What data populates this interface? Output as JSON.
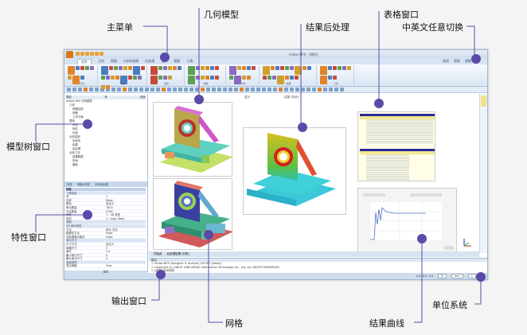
{
  "callouts": {
    "main_menu": "主菜单",
    "geometry_model": "几何模型",
    "post_processing": "结果后处理",
    "table_window": "表格窗口",
    "language_switch": "中英文任意切换",
    "model_tree_window": "模型树窗口",
    "property_window": "特性窗口",
    "output_window": "输出窗口",
    "mesh": "网格",
    "result_curve": "结果曲线",
    "unit_system": "单位系统"
  },
  "app": {
    "title": "midas NFX - [模型]",
    "tabs": [
      "文件",
      "几何",
      "网格",
      "分析&结果",
      "后处理",
      "工具",
      "视图",
      "工具"
    ],
    "right_menu": [
      "选项",
      "帮助",
      "视图"
    ],
    "ribbon_groups": [
      "几何",
      "特征",
      "变换",
      "网格",
      "分析",
      "结果",
      "工具"
    ],
    "tree": {
      "header": [
        "模型",
        "号",
        "颜色"
      ],
      "items": [
        "midas NFX 分析模型",
        "几何",
        "网格控制",
        "网格",
        "工作平面",
        "载荷",
        "材料",
        "特性",
        "约束",
        "分析控制",
        "坐标系",
        "结果",
        "后处理",
        "分析工况",
        "结果数据",
        "查询",
        "截面"
      ]
    },
    "panel_tabs": [
      "特性",
      "网格&属性",
      "分析和结果"
    ],
    "properties": {
      "title": "特性",
      "rows": [
        {
          "type": "cat",
          "label": "一般信息"
        },
        {
          "label": "号",
          "value": "1"
        },
        {
          "label": "名称",
          "value": "Steel"
        },
        {
          "label": "颜色",
          "value": "自定义"
        },
        {
          "label": "单元数量",
          "value": "1403"
        },
        {
          "label": "节点数量",
          "value": "2763"
        },
        {
          "label": "特性",
          "value": "1 : 3D 特性"
        },
        {
          "label": "材料",
          "value": "1 : Alloy Steel"
        },
        {
          "type": "cat",
          "label": "类型"
        },
        {
          "type": "cat",
          "label": "3D 单元特性"
        },
        {
          "label": "方法",
          "value": "积分 方法"
        },
        {
          "label": "稳健性方法",
          "value": "False"
        },
        {
          "label": "非协调单元模式",
          "value": "False"
        },
        {
          "type": "cat",
          "label": "单元尺寸"
        },
        {
          "label": "尺寸方式",
          "value": "自定义"
        },
        {
          "label": "网格尺寸",
          "value": "5"
        },
        {
          "label": "增长",
          "value": "1.0"
        },
        {
          "label": "最小单元尺寸",
          "value": "0"
        },
        {
          "label": "最大单元尺寸",
          "value": "0"
        },
        {
          "type": "cat",
          "label": "高级选项"
        },
        {
          "label": "显示网格",
          "value": "True"
        }
      ],
      "footer": "属性"
    },
    "view_toolbar": [
      "显示",
      "结果 (关闭)"
    ],
    "doc_tabs": [
      "开始页",
      "后处理结果 (分析)"
    ],
    "output": {
      "title": "输出",
      "lines": [
        "> midas NFX (Designer & Analyst) 2013R1 [Basic]",
        "> Copyright (C) SINCE 1989 MIDAS Information Technology Co., Ltd. ALL RIGHTS RESERVED.",
        "> [信息] 启动完成"
      ]
    },
    "status": {
      "coords": "0.0, 0.0, 0.0",
      "unit_force": "N",
      "unit_length": "mm",
      "unit_temp": "C"
    }
  },
  "colors": {
    "accent": "#5b4aa8",
    "ribbon": "#dbe6f3",
    "frame": "#9fb6cf"
  }
}
